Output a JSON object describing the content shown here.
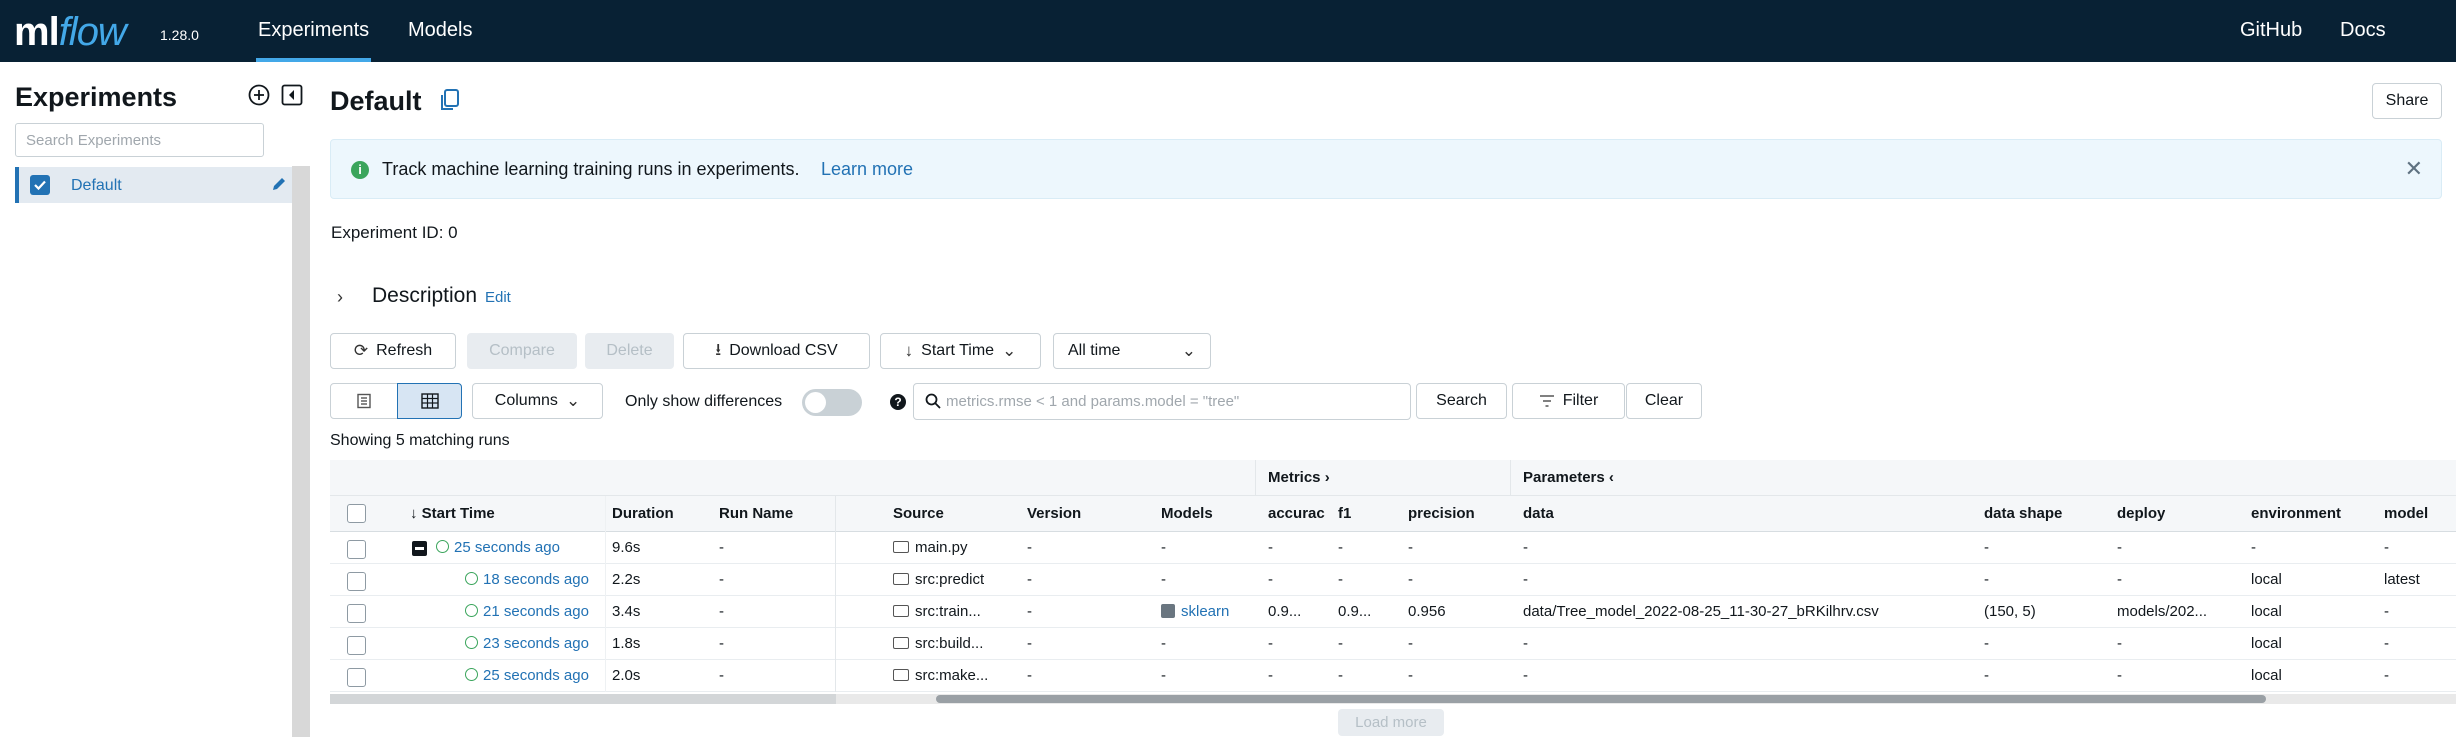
{
  "app": {
    "logo_ml": "ml",
    "logo_flow": "flow",
    "version": "1.28.0",
    "nav": [
      {
        "label": "Experiments",
        "active": true
      },
      {
        "label": "Models",
        "active": false
      }
    ],
    "right_links": [
      "GitHub",
      "Docs"
    ]
  },
  "sidebar": {
    "title": "Experiments",
    "search_placeholder": "Search Experiments",
    "items": [
      {
        "label": "Default",
        "checked": true
      }
    ]
  },
  "main": {
    "title": "Default",
    "share_label": "Share",
    "banner_text": "Track machine learning training runs in experiments.",
    "banner_link": "Learn more",
    "experiment_id_label": "Experiment ID:",
    "experiment_id_value": "0",
    "description_label": "Description",
    "description_edit": "Edit"
  },
  "toolbar": {
    "refresh": "Refresh",
    "compare": "Compare",
    "delete": "Delete",
    "download_csv": "Download CSV",
    "sort": "Start Time",
    "time_range": "All time",
    "columns": "Columns",
    "only_diff": "Only show differences",
    "search_placeholder": "metrics.rmse < 1 and params.model = \"tree\"",
    "search": "Search",
    "filter": "Filter",
    "clear": "Clear"
  },
  "runs_summary": "Showing 5 matching runs",
  "table": {
    "groups": {
      "metrics": "Metrics",
      "parameters": "Parameters"
    },
    "columns": [
      "Start Time",
      "Duration",
      "Run Name",
      "Source",
      "Version",
      "Models",
      "accurac",
      "f1",
      "precision",
      "data",
      "data shape",
      "deploy",
      "environment",
      "model"
    ],
    "rows": [
      {
        "start": "25 seconds ago",
        "duration": "9.6s",
        "run_name": "-",
        "source": "main.py",
        "version": "-",
        "models": "-",
        "acc": "-",
        "f1": "-",
        "precision": "-",
        "data": "-",
        "shape": "-",
        "deploy": "-",
        "env": "-",
        "model": "-"
      },
      {
        "start": "18 seconds ago",
        "duration": "2.2s",
        "run_name": "-",
        "source": "src:predict",
        "version": "-",
        "models": "-",
        "acc": "-",
        "f1": "-",
        "precision": "-",
        "data": "-",
        "shape": "-",
        "deploy": "-",
        "env": "local",
        "model": "latest"
      },
      {
        "start": "21 seconds ago",
        "duration": "3.4s",
        "run_name": "-",
        "source": "src:train...",
        "version": "-",
        "models": "sklearn",
        "acc": "0.9...",
        "f1": "0.9...",
        "precision": "0.956",
        "data": "data/Tree_model_2022-08-25_11-30-27_bRKilhrv.csv",
        "shape": "(150, 5)",
        "deploy": "models/202...",
        "env": "local",
        "model": "-"
      },
      {
        "start": "23 seconds ago",
        "duration": "1.8s",
        "run_name": "-",
        "source": "src:build...",
        "version": "-",
        "models": "-",
        "acc": "-",
        "f1": "-",
        "precision": "-",
        "data": "-",
        "shape": "-",
        "deploy": "-",
        "env": "local",
        "model": "-"
      },
      {
        "start": "25 seconds ago",
        "duration": "2.0s",
        "run_name": "-",
        "source": "src:make...",
        "version": "-",
        "models": "-",
        "acc": "-",
        "f1": "-",
        "precision": "-",
        "data": "-",
        "shape": "-",
        "deploy": "-",
        "env": "local",
        "model": "-"
      }
    ]
  },
  "load_more": "Load more",
  "colors": {
    "nav_bg": "#082134",
    "accent": "#2272b4",
    "success": "#3ba55c"
  }
}
